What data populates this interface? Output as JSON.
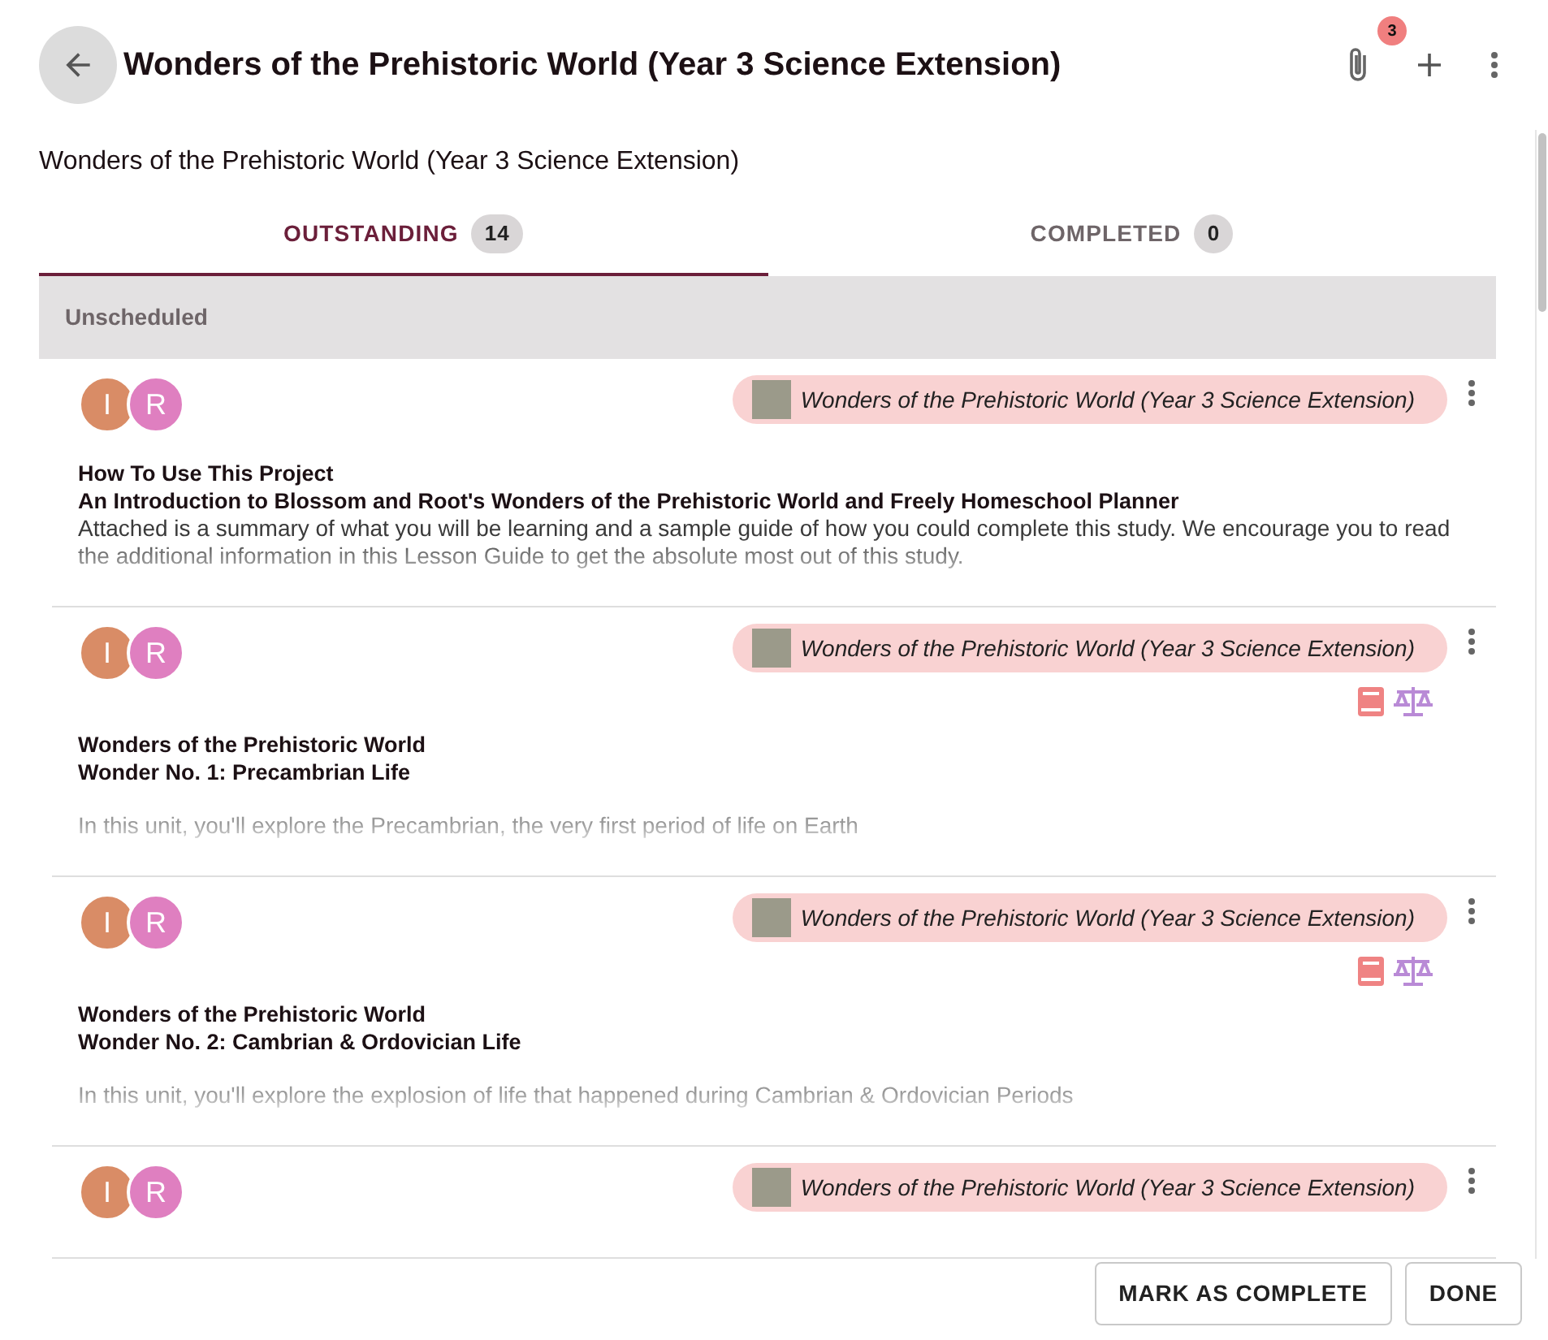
{
  "header": {
    "title": "Wonders of the Prehistoric World (Year 3 Science Extension)",
    "attachment_count": "3"
  },
  "subtitle": "Wonders of the Prehistoric World (Year 3 Science Extension)",
  "tabs": [
    {
      "label": "OUTSTANDING",
      "count": "14",
      "selected": true
    },
    {
      "label": "COMPLETED",
      "count": "0",
      "selected": false
    }
  ],
  "section": "Unscheduled",
  "cards": [
    {
      "avatars": [
        {
          "initial": "I",
          "color": "#d98c66"
        },
        {
          "initial": "R",
          "color": "#df7fc0"
        }
      ],
      "chip": "Wonders of the Prehistoric World (Year 3 Science Extension)",
      "title": "How To Use This Project",
      "subtitle": "An Introduction to Blossom and Root's Wonders of the Prehistoric World and Freely Homeschool Planner",
      "description": "Attached is a summary of what you will be learning and a sample guide of how you could complete this study. We encourage you to read the additional information in this Lesson Guide to get the absolute most out of this study."
    },
    {
      "avatars": [
        {
          "initial": "I",
          "color": "#d98c66"
        },
        {
          "initial": "R",
          "color": "#df7fc0"
        }
      ],
      "chip": "Wonders of the Prehistoric World (Year 3 Science Extension)",
      "icons": [
        {
          "kind": "book"
        },
        {
          "kind": "scale"
        }
      ],
      "title": "Wonders of the Prehistoric World",
      "subtitle": "Wonder No. 1: Precambrian Life",
      "description": "In this unit, you'll explore the Precambrian, the very first period of life on Earth"
    },
    {
      "avatars": [
        {
          "initial": "I",
          "color": "#d98c66"
        },
        {
          "initial": "R",
          "color": "#df7fc0"
        }
      ],
      "chip": "Wonders of the Prehistoric World (Year 3 Science Extension)",
      "icons": [
        {
          "kind": "book"
        },
        {
          "kind": "scale"
        }
      ],
      "title": "Wonders of the Prehistoric World",
      "subtitle": "Wonder No. 2: Cambrian & Ordovician Life",
      "description": "In this unit, you'll explore the explosion of life that happened during Cambrian & Ordovician Periods"
    },
    {
      "avatars": [
        {
          "initial": "I",
          "color": "#d98c66"
        },
        {
          "initial": "R",
          "color": "#df7fc0"
        }
      ],
      "chip": "Wonders of the Prehistoric World (Year 3 Science Extension)"
    }
  ],
  "buttons": [
    "MARK AS COMPLETE",
    "DONE"
  ]
}
